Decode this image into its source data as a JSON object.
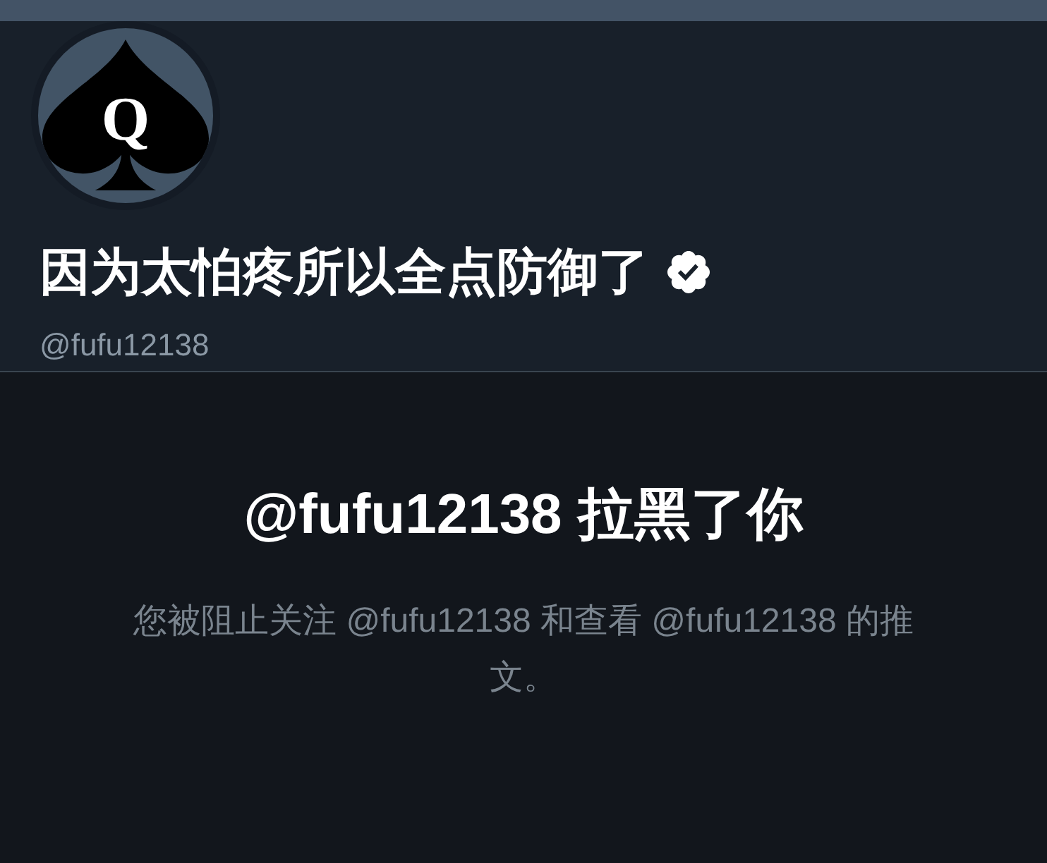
{
  "profile": {
    "avatar": {
      "letter": "Q"
    },
    "display_name": "因为太怕疼所以全点防御了",
    "verified": true,
    "handle": "@fufu12138"
  },
  "blocked_notice": {
    "title": "@fufu12138 拉黑了你",
    "message": "您被阻止关注 @fufu12138 和查看 @fufu12138 的推文。"
  }
}
